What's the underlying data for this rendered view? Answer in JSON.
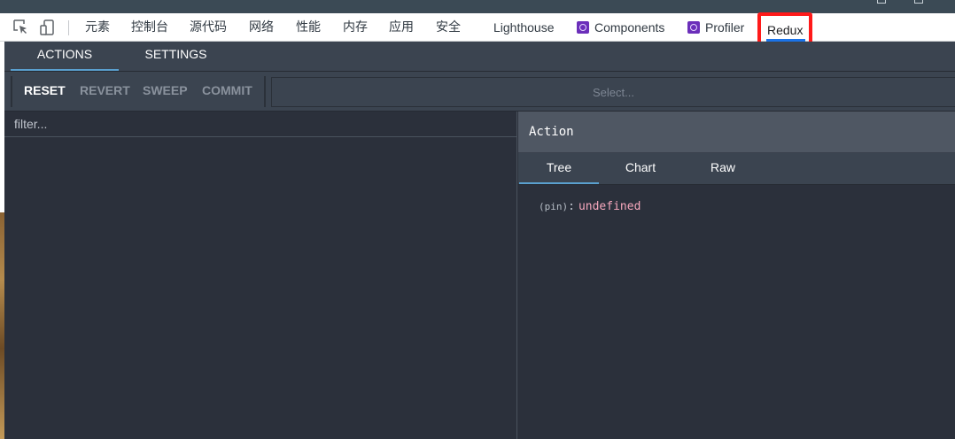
{
  "devtools": {
    "tabs": [
      {
        "label": "元素"
      },
      {
        "label": "控制台"
      },
      {
        "label": "源代码"
      },
      {
        "label": "网络"
      },
      {
        "label": "性能"
      },
      {
        "label": "内存"
      },
      {
        "label": "应用"
      },
      {
        "label": "安全"
      },
      {
        "label": "Lighthouse"
      },
      {
        "label": "Components",
        "icon": "react-icon"
      },
      {
        "label": "Profiler",
        "icon": "react-icon"
      }
    ],
    "active_tab": "Redux",
    "highlight_color": "#ff1a1a",
    "accent_color": "#1a73e8"
  },
  "redux": {
    "subtabs": [
      "ACTIONS",
      "SETTINGS"
    ],
    "active_subtab": "ACTIONS",
    "toolbar": {
      "reset": "RESET",
      "revert": "REVERT",
      "sweep": "SWEEP",
      "commit": "COMMIT",
      "select_placeholder": "Select..."
    },
    "filter_placeholder": "filter...",
    "inspector": {
      "title": "Action",
      "tabs": [
        "Tree",
        "Chart",
        "Raw"
      ],
      "active_tab": "Tree",
      "tree": {
        "key": "(pin)",
        "value": "undefined"
      }
    },
    "colors": {
      "background": "#2b303b",
      "panel": "#3b4450",
      "active_underline": "#5aa0cf",
      "value": "#f7a8bd"
    }
  }
}
